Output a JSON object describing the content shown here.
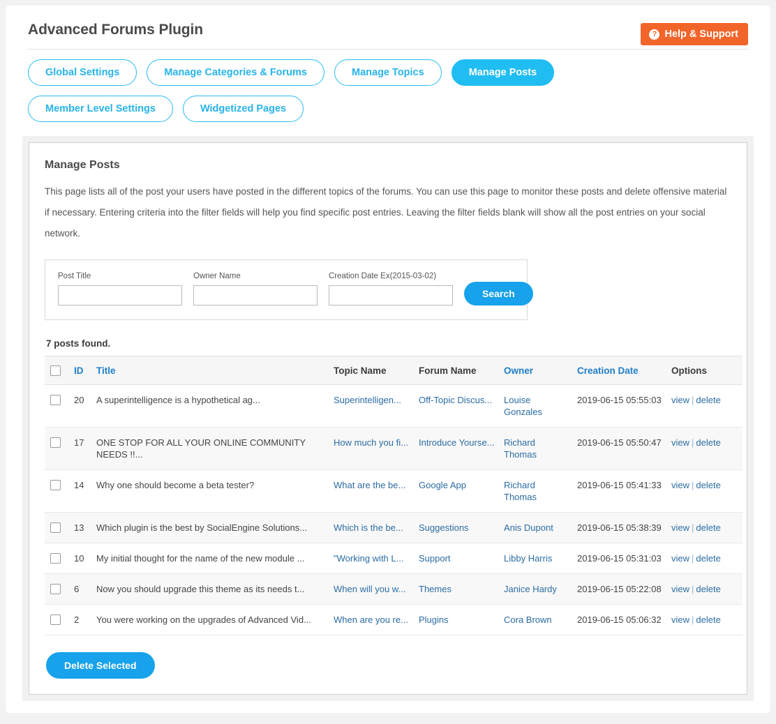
{
  "header": {
    "title": "Advanced Forums Plugin",
    "help_button": "Help & Support",
    "help_icon": "question-circle-icon"
  },
  "tabs": [
    {
      "label": "Global Settings",
      "active": false
    },
    {
      "label": "Manage Categories & Forums",
      "active": false
    },
    {
      "label": "Manage Topics",
      "active": false
    },
    {
      "label": "Manage Posts",
      "active": true
    },
    {
      "label": "Member Level Settings",
      "active": false
    },
    {
      "label": "Widgetized Pages",
      "active": false
    }
  ],
  "main": {
    "section_title": "Manage Posts",
    "description": "This page lists all of the post your users have posted in the different topics of the forums. You can use this page to monitor these posts and delete offensive material if necessary. Entering criteria into the filter fields will help you find specific post entries. Leaving the filter fields blank will show all the post entries on your social network.",
    "results_count": "7 posts found.",
    "delete_selected_label": "Delete Selected"
  },
  "filter": {
    "post_title_label": "Post Title",
    "post_title_value": "",
    "owner_name_label": "Owner Name",
    "owner_name_value": "",
    "creation_date_label": "Creation Date Ex(2015-03-02)",
    "creation_date_value": "",
    "search_label": "Search"
  },
  "table": {
    "columns": [
      {
        "label": "",
        "key": "checkbox",
        "is_link": false
      },
      {
        "label": "ID",
        "key": "id",
        "is_link": true
      },
      {
        "label": "Title",
        "key": "title",
        "is_link": true
      },
      {
        "label": "Topic Name",
        "key": "topic",
        "is_link": false
      },
      {
        "label": "Forum Name",
        "key": "forum",
        "is_link": false
      },
      {
        "label": "Owner",
        "key": "owner",
        "is_link": true
      },
      {
        "label": "Creation Date",
        "key": "date",
        "is_link": true
      },
      {
        "label": "Options",
        "key": "options",
        "is_link": false
      }
    ],
    "option_view": "view",
    "option_delete": "delete",
    "option_separator": "|",
    "rows": [
      {
        "id": "20",
        "title": "A superintelligence is a hypothetical ag...",
        "topic": "Superintelligen...",
        "forum": "Off-Topic Discus...",
        "owner": "Louise Gonzales",
        "date": "2019-06-15 05:55:03"
      },
      {
        "id": "17",
        "title": "ONE STOP FOR ALL YOUR ONLINE COMMUNITY NEEDS !!...",
        "topic": "How much you fi...",
        "forum": "Introduce Yourse...",
        "owner": "Richard Thomas",
        "date": "2019-06-15 05:50:47"
      },
      {
        "id": "14",
        "title": "Why one should become a beta tester?",
        "topic": "What are the be...",
        "forum": "Google App",
        "owner": "Richard Thomas",
        "date": "2019-06-15 05:41:33"
      },
      {
        "id": "13",
        "title": "Which plugin is the best by SocialEngine Solutions...",
        "topic": "Which is the be...",
        "forum": "Suggestions",
        "owner": "Anis Dupont",
        "date": "2019-06-15 05:38:39"
      },
      {
        "id": "10",
        "title": "My initial thought for the name of the new module ...",
        "topic": "\"Working with L...",
        "forum": "Support",
        "owner": "Libby Harris",
        "date": "2019-06-15 05:31:03"
      },
      {
        "id": "6",
        "title": "Now you should upgrade this theme as its needs t...",
        "topic": "When will you w...",
        "forum": "Themes",
        "owner": "Janice Hardy",
        "date": "2019-06-15 05:22:08"
      },
      {
        "id": "2",
        "title": "You were working on the upgrades of Advanced Vid...",
        "topic": "When are you re...",
        "forum": "Plugins",
        "owner": "Cora Brown",
        "date": "2019-06-15 05:06:32"
      }
    ]
  },
  "colors": {
    "accent_cyan": "#20bdf2",
    "button_blue": "#17a2eb",
    "help_orange": "#f2652a",
    "link_blue": "#2b6ca3",
    "header_link_blue": "#1e7ec8"
  }
}
